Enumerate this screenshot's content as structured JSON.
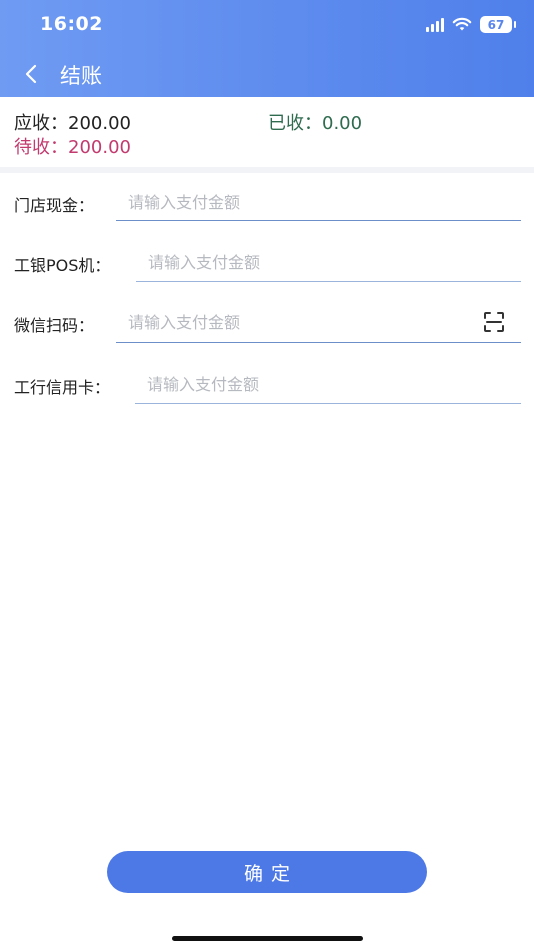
{
  "status_bar": {
    "time": "16:02",
    "battery": "67"
  },
  "nav": {
    "title": "结账"
  },
  "summary": {
    "receivable_label": "应收：",
    "receivable_value": "200.00",
    "received_label": "已收：",
    "received_value": "0.00",
    "pending_label": "待收：",
    "pending_value": "200.00",
    "colors": {
      "received": "#2f6b4f",
      "pending": "#c23a6e"
    }
  },
  "payments": [
    {
      "label": "门店现金：",
      "placeholder": "请输入支付金额",
      "value": ""
    },
    {
      "label": "工银POS机：",
      "placeholder": "请输入支付金额",
      "value": ""
    },
    {
      "label": "微信扫码：",
      "placeholder": "请输入支付金额",
      "value": "",
      "icon": "scan-icon"
    },
    {
      "label": "工行信用卡：",
      "placeholder": "请输入支付金额",
      "value": ""
    }
  ],
  "footer": {
    "confirm_label": "确定"
  },
  "theme": {
    "header_start": "#6f9bf3",
    "header_end": "#4f7fea",
    "button": "#4d79e6"
  }
}
